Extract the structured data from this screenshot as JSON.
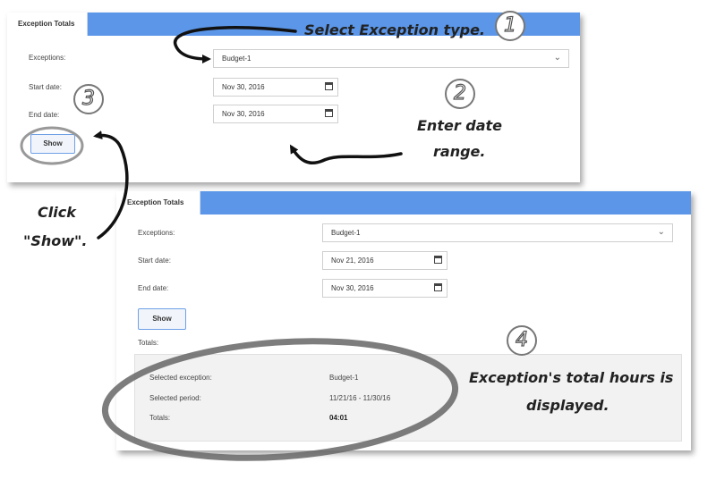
{
  "panel_top": {
    "tab": "Exception Totals",
    "exceptions_label": "Exceptions:",
    "exception_value": "Budget-1",
    "start_label": "Start date:",
    "start_value": "Nov 30, 2016",
    "end_label": "End date:",
    "end_value": "Nov 30, 2016",
    "show_label": "Show"
  },
  "panel_bottom": {
    "tab": "Exception Totals",
    "exceptions_label": "Exceptions:",
    "exception_value": "Budget-1",
    "start_label": "Start date:",
    "start_value": "Nov 21, 2016",
    "end_label": "End date:",
    "end_value": "Nov 30, 2016",
    "show_label": "Show",
    "totals_heading": "Totals:",
    "selected_exception_label": "Selected exception:",
    "selected_exception_value": "Budget-1",
    "selected_period_label": "Selected period:",
    "selected_period_value": "11/21/16 - 11/30/16",
    "totals_label": "Totals:",
    "totals_value": "04:01"
  },
  "annotations": {
    "step1_text": "Select Exception type.",
    "step2_line1": "Enter date",
    "step2_line2": "range.",
    "step3_line1": "Click",
    "step3_line2": "\"Show\".",
    "step4_line1": "Exception's total hours is",
    "step4_line2": "displayed.",
    "num1": "1",
    "num2": "2",
    "num3": "3",
    "num4": "4"
  },
  "colors": {
    "tab_bar": "#5b96e8",
    "button_border": "#6ea0e6",
    "totals_bg": "#f2f2f2"
  },
  "icons": {
    "calendar": "calendar-icon",
    "dropdown": "chevron-down-icon"
  }
}
